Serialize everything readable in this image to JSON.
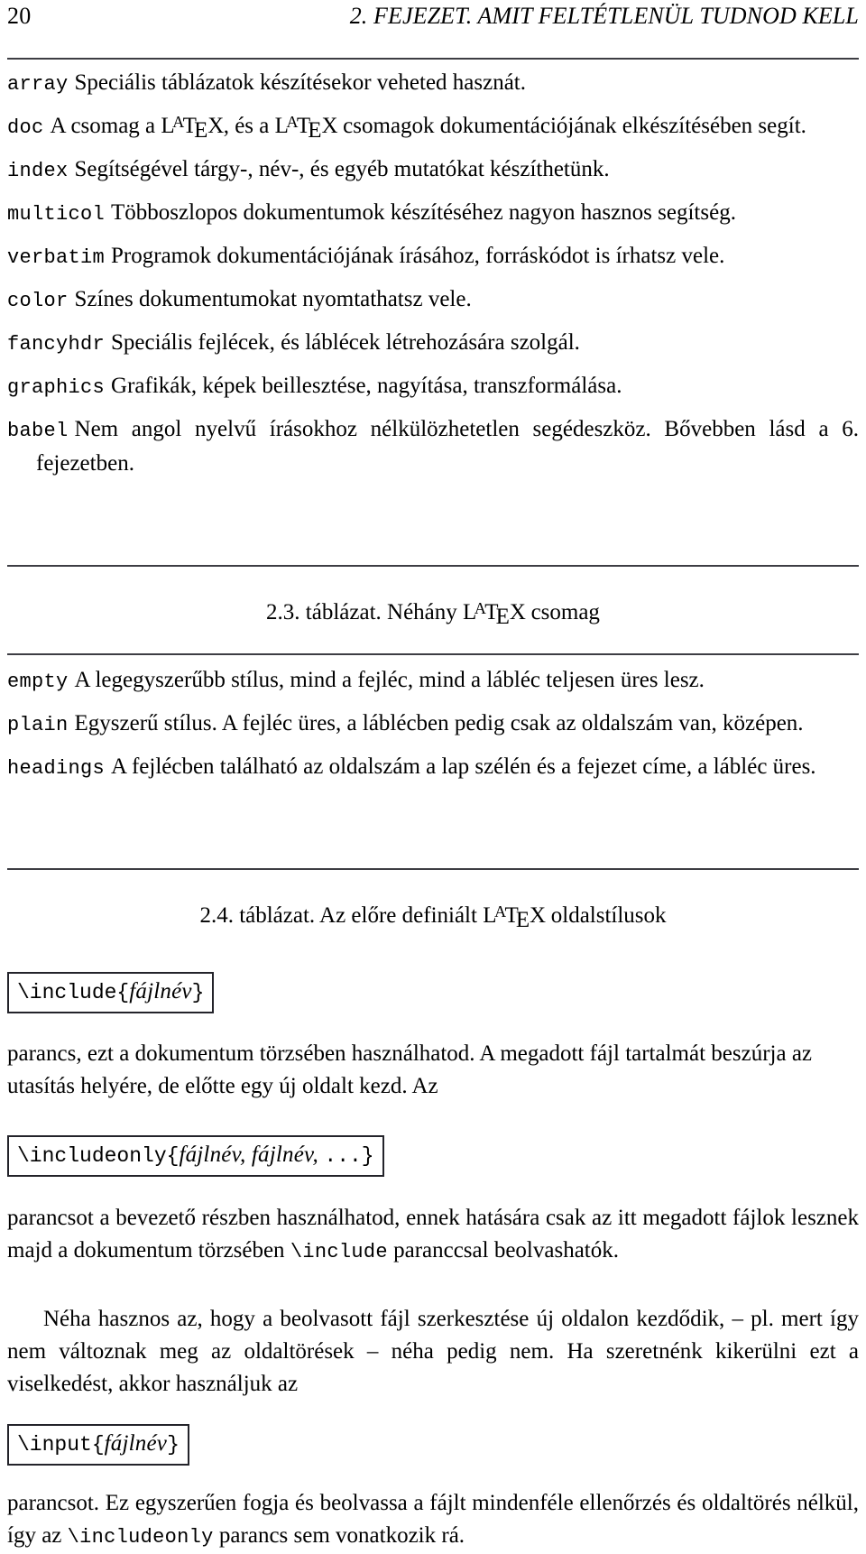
{
  "header": {
    "folio": "20",
    "running_title": "2. FEJEZET. AMIT FELTÉTLENÜL TUDNOD KELL"
  },
  "table_2_3": {
    "caption_prefix": "2.3. táblázat. Néhány ",
    "caption_suffix": " csomag",
    "items": [
      {
        "term": "array",
        "desc": "Speciális táblázatok készítésekor veheted hasznát."
      },
      {
        "term": "doc",
        "desc_part1": "A csomag a ",
        "desc_part2": ", és a ",
        "desc_part3": " csomagok dokumentációjának elkészítésében segít."
      },
      {
        "term": "index",
        "desc": "Segítségével tárgy-, név-, és egyéb mutatókat készíthetünk."
      },
      {
        "term": "multicol",
        "desc": "Többoszlopos dokumentumok készítéséhez nagyon hasznos segítség."
      },
      {
        "term": "verbatim",
        "desc": "Programok dokumentációjának írásához, forráskódot is írhatsz vele."
      },
      {
        "term": "color",
        "desc": "Színes dokumentumokat nyomtathatsz vele."
      },
      {
        "term": "fancyhdr",
        "desc": "Speciális fejlécek, és láblécek létrehozására szolgál."
      },
      {
        "term": "graphics",
        "desc": "Grafikák, képek beillesztése, nagyítása, transzformálása."
      },
      {
        "term": "babel",
        "desc": "Nem angol nyelvű írásokhoz nélkülözhetetlen segédeszköz.  Bővebben lásd a 6. fejezetben."
      }
    ]
  },
  "table_2_4": {
    "caption_prefix": "2.4. táblázat. Az előre definiált ",
    "caption_suffix": " oldalstílusok",
    "items": [
      {
        "term": "empty",
        "desc": "A legegyszerűbb stílus, mind a fejléc, mind a lábléc teljesen üres lesz."
      },
      {
        "term": "plain",
        "desc": "Egyszerű stílus. A fejléc üres, a láblécben pedig csak az oldalszám van, középen."
      },
      {
        "term": "headings",
        "desc": "A fejlécben található az oldalszám a lap szélén és a fejezet címe, a lábléc üres."
      }
    ]
  },
  "code_boxes": {
    "include": {
      "command": "\\include{",
      "arg": "fájlnév",
      "close": "}"
    },
    "includeonly": {
      "command": "\\includeonly{",
      "arg": "fájlnév, fájlnév, ",
      "close": "...}"
    },
    "input": {
      "command": "\\input{",
      "arg": "fájlnév",
      "close": "}"
    }
  },
  "paragraphs": {
    "after_include": "parancs, ezt a dokumentum törzsében használhatod. A megadott fájl tartalmát beszúrja az utasítás helyére, de előtte egy új oldalt kezd. Az",
    "after_includeonly_a": "parancsot a bevezető részben használhatod, ennek hatására csak az itt megadott fájlok lesznek majd a dokumentum törzsében ",
    "after_includeonly_cmd": "\\include",
    "after_includeonly_b": " paranccsal beolvashatók.",
    "note": "Néha hasznos az, hogy a beolvasott fájl szerkesztése új oldalon kezdődik, – pl. mert így nem változnak meg az oldaltörések – néha pedig nem. Ha szeretnénk kikerülni ezt a viselkedést, akkor használjuk az",
    "after_input_a": "parancsot.  Ez egyszerűen fogja és beolvassa a fájlt mindenféle ellenőrzés és oldaltörés nélkül, így az ",
    "after_input_cmd": "\\includeonly",
    "after_input_b": " parancs sem vonatkozik rá."
  },
  "logo": {
    "l": "L",
    "a": "A",
    "t": "T",
    "e": "E",
    "x": "X"
  },
  "colors": {
    "text": "#000000",
    "rule": "#3d3d43",
    "box_border": "#23232a",
    "page": "#ffffff"
  }
}
